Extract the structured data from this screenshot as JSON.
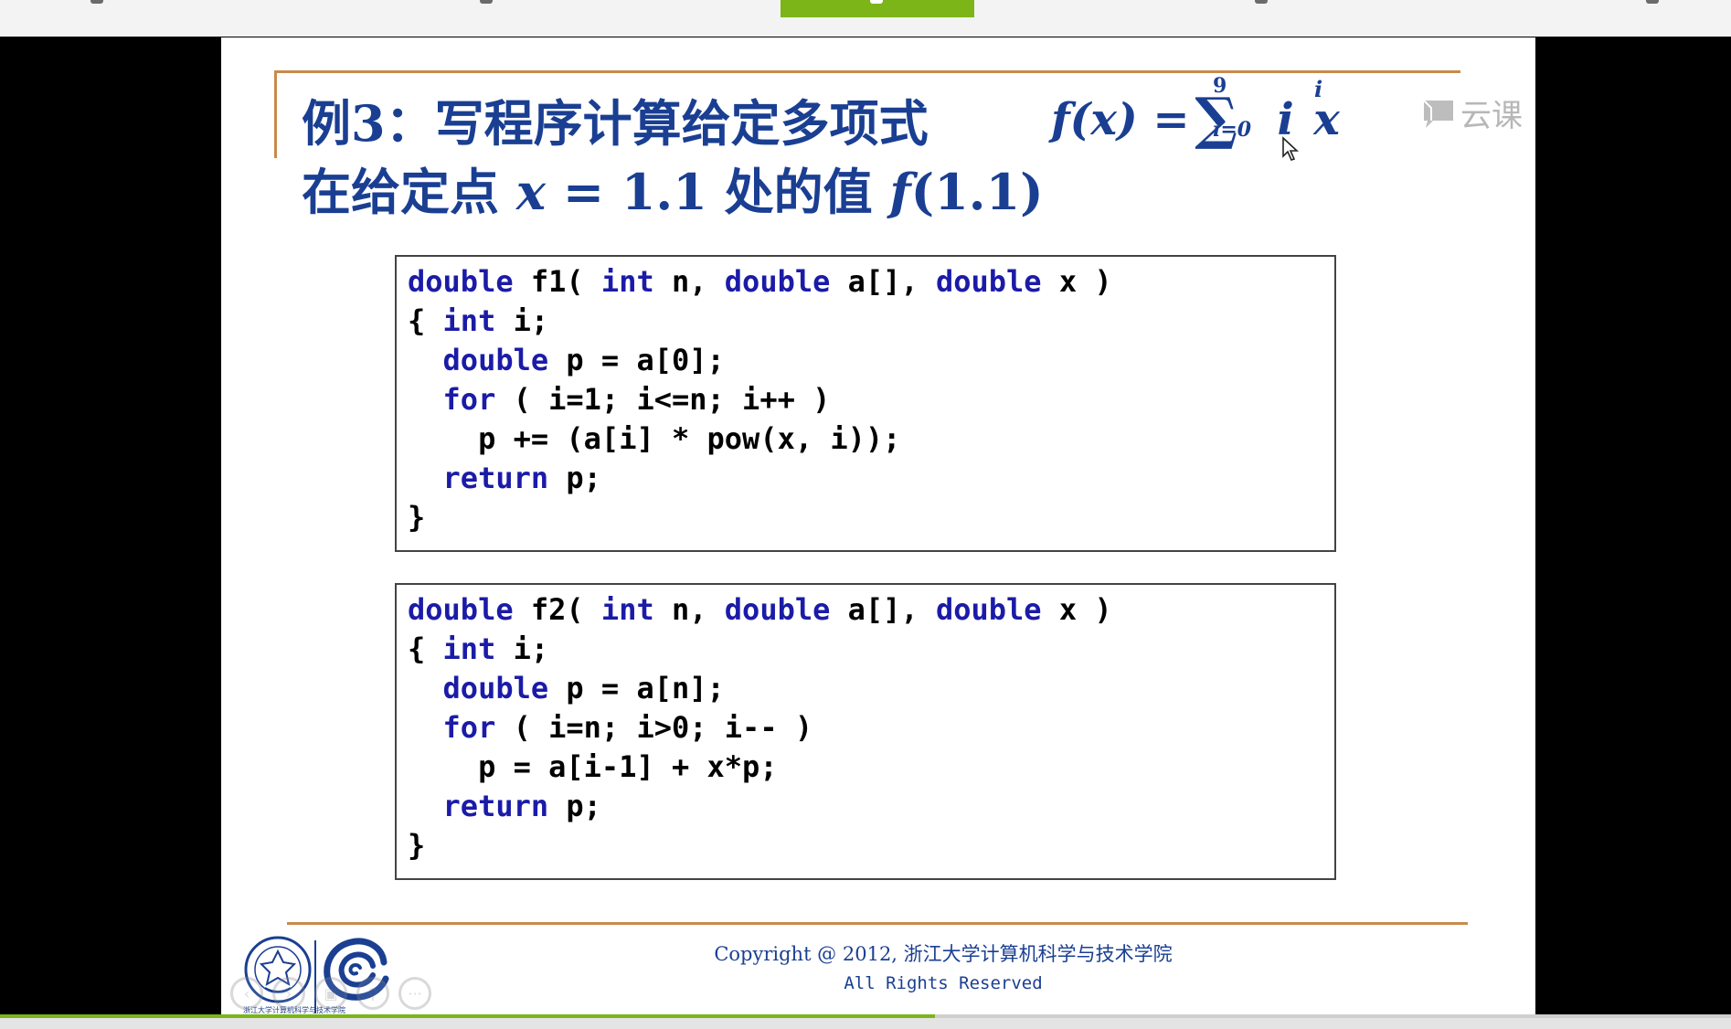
{
  "slide": {
    "title_line1": "例3：写程序计算给定多项式",
    "title_line2_part1": "在给定点 ",
    "title_line2_math": "x",
    "title_line2_part2": " = 1.1 处的值 ",
    "title_line2_func": "f",
    "title_line2_part3": "(1.1)",
    "formula": {
      "lhs": "f(x) =",
      "sum_symbol": "∑",
      "sum_upper": "9",
      "sum_lower": "i=0",
      "term_coef": "i",
      "term_base": "x",
      "term_exp": "i"
    },
    "watermark_text": "云课",
    "code_f1": [
      [
        {
          "t": "double",
          "k": true
        },
        {
          "t": " f1( "
        },
        {
          "t": "int",
          "k": true
        },
        {
          "t": " n, "
        },
        {
          "t": "double",
          "k": true
        },
        {
          "t": " a[], "
        },
        {
          "t": "double",
          "k": true
        },
        {
          "t": " x )"
        }
      ],
      [
        {
          "t": "{ "
        },
        {
          "t": "int",
          "k": true
        },
        {
          "t": " i;"
        }
      ],
      [
        {
          "t": "  "
        },
        {
          "t": "double",
          "k": true
        },
        {
          "t": " p = a[0];"
        }
      ],
      [
        {
          "t": "  "
        },
        {
          "t": "for",
          "k": true
        },
        {
          "t": " ( i=1; i<=n; i++ )"
        }
      ],
      [
        {
          "t": "    p += (a[i] * pow(x, i));"
        }
      ],
      [
        {
          "t": "  "
        },
        {
          "t": "return",
          "k": true
        },
        {
          "t": " p;"
        }
      ],
      [
        {
          "t": "}"
        }
      ]
    ],
    "code_f2": [
      [
        {
          "t": "double",
          "k": true
        },
        {
          "t": " f2( "
        },
        {
          "t": "int",
          "k": true
        },
        {
          "t": " n, "
        },
        {
          "t": "double",
          "k": true
        },
        {
          "t": " a[], "
        },
        {
          "t": "double",
          "k": true
        },
        {
          "t": " x )"
        }
      ],
      [
        {
          "t": "{ "
        },
        {
          "t": "int",
          "k": true
        },
        {
          "t": " i;"
        }
      ],
      [
        {
          "t": "  "
        },
        {
          "t": "double",
          "k": true
        },
        {
          "t": " p = a[n];"
        }
      ],
      [
        {
          "t": "  "
        },
        {
          "t": "for",
          "k": true
        },
        {
          "t": " ( i=n; i>0; i-- )"
        }
      ],
      [
        {
          "t": "    p = a[i-1] + x*p;"
        }
      ],
      [
        {
          "t": "  "
        },
        {
          "t": "return",
          "k": true
        },
        {
          "t": " p;"
        }
      ],
      [
        {
          "t": "}"
        }
      ]
    ],
    "copyright": "Copyright @ 2012, 浙江大学计算机科学与技术学院",
    "rights": "All Rights Reserved",
    "logo_caption": "浙江大学计算机科学与技术学院"
  },
  "player": {
    "progress": 0.54,
    "controls": [
      "prev-icon",
      "next-icon",
      "thumbnails-icon",
      "zoom-icon",
      "more-icon"
    ]
  },
  "colors": {
    "title": "#1a3f92",
    "keyword": "#1b1ba8",
    "accent_rule": "#c98a4b",
    "active_tab": "#7cb518"
  }
}
